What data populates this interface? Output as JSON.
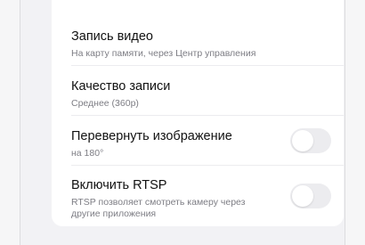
{
  "settings": {
    "items": [
      {
        "title": "Запись видео",
        "subtitle": "На карту памяти, через Центр управления"
      },
      {
        "title": "Качество записи",
        "subtitle": "Среднее (360p)"
      },
      {
        "title": "Перевернуть изображение",
        "subtitle": "на 180°",
        "toggle_on": false
      },
      {
        "title": "Включить RTSP",
        "subtitle_line1": "RTSP позволяет смотреть камеру через",
        "subtitle_line2": "другие приложения",
        "toggle_on": false
      }
    ]
  }
}
